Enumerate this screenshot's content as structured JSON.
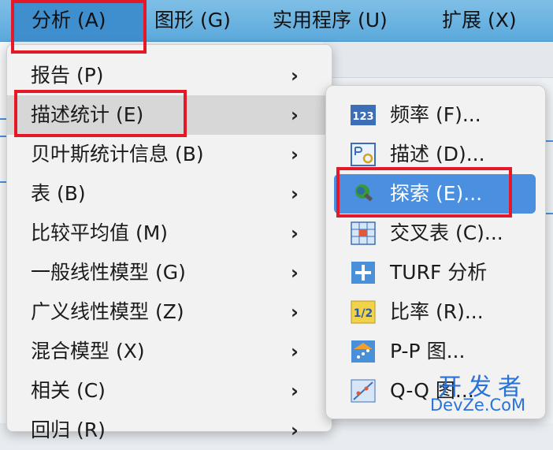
{
  "menubar": {
    "items": [
      {
        "label": "分析 (A)",
        "active": true
      },
      {
        "label": "图形 (G)"
      },
      {
        "label": "实用程序 (U)"
      },
      {
        "label": "扩展 (X)"
      }
    ]
  },
  "analysis_menu": {
    "items": [
      {
        "label": "报告 (P)"
      },
      {
        "label": "描述统计 (E)",
        "selected": true
      },
      {
        "label": "贝叶斯统计信息 (B)"
      },
      {
        "label": "表 (B)"
      },
      {
        "label": "比较平均值 (M)"
      },
      {
        "label": "一般线性模型 (G)"
      },
      {
        "label": "广义线性模型 (Z)"
      },
      {
        "label": "混合模型 (X)"
      },
      {
        "label": "相关 (C)"
      },
      {
        "label": "回归 (R)"
      }
    ],
    "arrow": "›"
  },
  "descriptive_submenu": {
    "items": [
      {
        "label": "频率 (F)...",
        "icon": "frequency-icon"
      },
      {
        "label": "描述 (D)...",
        "icon": "descriptives-icon"
      },
      {
        "label": "探索 (E)...",
        "icon": "explore-icon",
        "highlighted": true
      },
      {
        "label": "交叉表 (C)...",
        "icon": "crosstabs-icon"
      },
      {
        "label": "TURF 分析",
        "icon": "turf-icon"
      },
      {
        "label": "比率 (R)...",
        "icon": "ratio-icon"
      },
      {
        "label": "P-P 图...",
        "icon": "pp-plot-icon"
      },
      {
        "label": "Q-Q 图...",
        "icon": "qq-plot-icon"
      }
    ]
  },
  "watermark": {
    "line1": "开发者",
    "line2": "DevZe.CoM"
  },
  "colors": {
    "accent": "#4a8fe0",
    "highlight_box": "#e3192a",
    "menubar": "#5aa9dc"
  }
}
